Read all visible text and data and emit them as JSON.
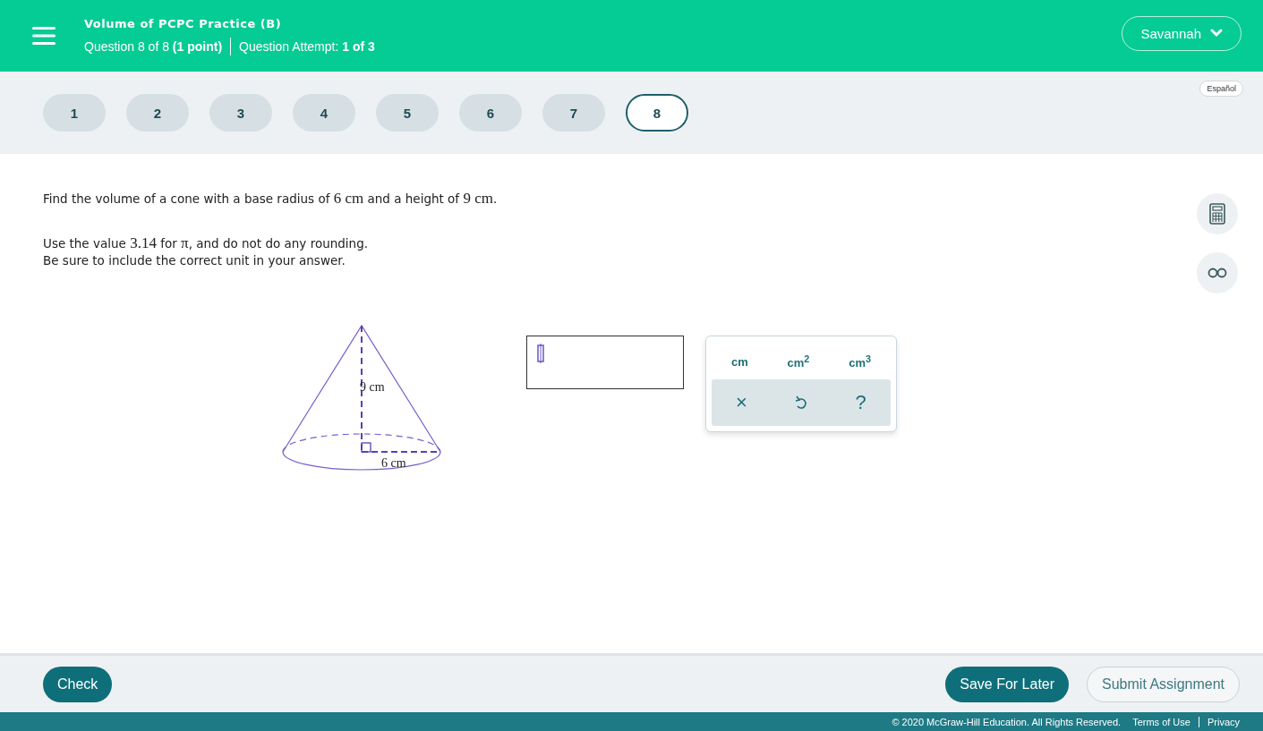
{
  "header": {
    "title": "Volume of PCPC Practice (B)",
    "question_info": "Question 8 of 8 **(1 point)**",
    "attempt_info": "Question Attempt: **1 of 3**",
    "user": "Savannah"
  },
  "question_nav": [
    {
      "label": "1",
      "selected": false
    },
    {
      "label": "2",
      "selected": false
    },
    {
      "label": "3",
      "selected": false
    },
    {
      "label": "4",
      "selected": false
    },
    {
      "label": "5",
      "selected": false
    },
    {
      "label": "6",
      "selected": false
    },
    {
      "label": "7",
      "selected": false
    },
    {
      "label": "8",
      "selected": true
    }
  ],
  "language_button": "Español",
  "question": {
    "paragraphs": [
      [
        {
          "kind": "text",
          "text": "Find the volume of a cone with a base radius of "
        },
        {
          "kind": "math",
          "text": "6 cm"
        },
        {
          "kind": "text",
          "text": " and a height of "
        },
        {
          "kind": "math",
          "text": "9 cm"
        },
        {
          "kind": "text",
          "text": "."
        }
      ],
      [
        {
          "kind": "text",
          "text": "Use the value "
        },
        {
          "kind": "math",
          "text": "3.14"
        },
        {
          "kind": "text",
          "text": " for "
        },
        {
          "kind": "math",
          "text": "π"
        },
        {
          "kind": "text",
          "text": ", and do not do any rounding."
        }
      ],
      [
        {
          "kind": "text",
          "text": "Be sure to include the correct unit in your answer."
        }
      ]
    ],
    "figure_labels": {
      "height": "9 cm",
      "radius": "6 cm"
    }
  },
  "unit_palette": {
    "units": [
      "cm",
      "cm$^{2}$",
      "cm$^{3}$"
    ],
    "actions": [
      {
        "kind": "clear",
        "symbol": "×"
      },
      {
        "kind": "undo"
      },
      {
        "kind": "help",
        "symbol": "?"
      }
    ]
  },
  "footer": {
    "check": "Check",
    "save": "Save For Later",
    "submit": "Submit Assignment",
    "copyright": "© 2020 McGraw-Hill Education. All Rights Reserved.",
    "links": [
      "Terms of Use",
      "Privacy"
    ]
  }
}
